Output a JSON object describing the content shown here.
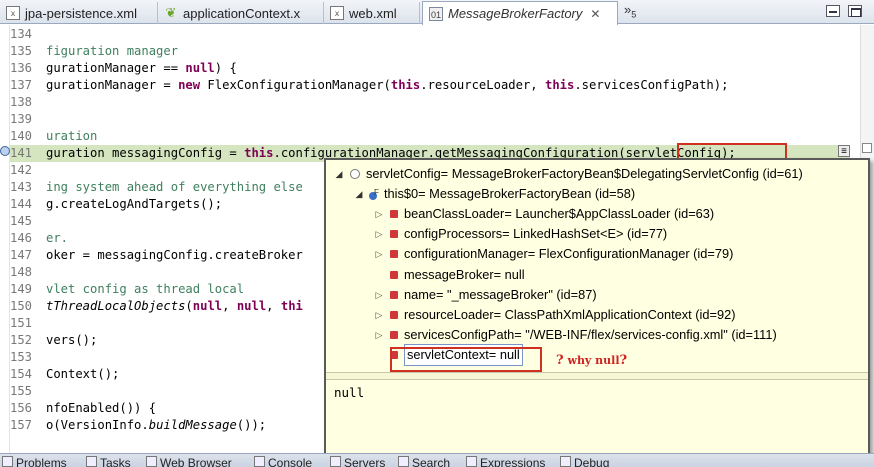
{
  "tabs": [
    {
      "label": "jpa-persistence.xml",
      "icon": "xml-file-icon",
      "active": false
    },
    {
      "label": "applicationContext.x",
      "icon": "spring-leaf-icon",
      "active": false
    },
    {
      "label": "web.xml",
      "icon": "xml-file-icon",
      "active": false
    },
    {
      "label": "MessageBrokerFactory",
      "icon": "class-file-icon",
      "active": true
    }
  ],
  "tab_overflow": {
    "symbol": "»",
    "count": "5"
  },
  "editor": {
    "lines": [
      {
        "num": "134",
        "segments": []
      },
      {
        "num": "135",
        "segments": [
          {
            "t": "figuration manager",
            "c": "cmt"
          }
        ]
      },
      {
        "num": "136",
        "segments": [
          {
            "t": "gurationManager == ",
            "c": ""
          },
          {
            "t": "null",
            "c": "kw"
          },
          {
            "t": ") {",
            "c": ""
          }
        ]
      },
      {
        "num": "137",
        "segments": [
          {
            "t": "gurationManager = ",
            "c": ""
          },
          {
            "t": "new",
            "c": "kw"
          },
          {
            "t": " FlexConfigurationManager(",
            "c": ""
          },
          {
            "t": "this",
            "c": "kw"
          },
          {
            "t": ".resourceLoader, ",
            "c": ""
          },
          {
            "t": "this",
            "c": "kw"
          },
          {
            "t": ".servicesConfigPath);",
            "c": ""
          }
        ]
      },
      {
        "num": "138",
        "segments": []
      },
      {
        "num": "139",
        "segments": []
      },
      {
        "num": "140",
        "segments": [
          {
            "t": "uration",
            "c": "cmt"
          }
        ]
      },
      {
        "num": "141",
        "segments": [
          {
            "t": "guration messagingConfig = ",
            "c": ""
          },
          {
            "t": "this",
            "c": "kw"
          },
          {
            "t": ".configurationManager.getMessagingConfiguration(servletConfig);",
            "c": ""
          }
        ],
        "highlight": true
      },
      {
        "num": "142",
        "segments": []
      },
      {
        "num": "143",
        "segments": [
          {
            "t": "ing system ahead of everything else",
            "c": "cmt"
          }
        ]
      },
      {
        "num": "144",
        "segments": [
          {
            "t": "g.createLogAndTargets();",
            "c": ""
          }
        ]
      },
      {
        "num": "145",
        "segments": []
      },
      {
        "num": "146",
        "segments": [
          {
            "t": "er.",
            "c": "cmt"
          }
        ]
      },
      {
        "num": "147",
        "segments": [
          {
            "t": "oker = messagingConfig.createBroker",
            "c": ""
          }
        ]
      },
      {
        "num": "148",
        "segments": []
      },
      {
        "num": "149",
        "segments": [
          {
            "t": "vlet config as thread local",
            "c": "cmt"
          }
        ]
      },
      {
        "num": "150",
        "segments": [
          {
            "t": "tThreadLocalObjects",
            "c": "it"
          },
          {
            "t": "(",
            "c": ""
          },
          {
            "t": "null",
            "c": "kw"
          },
          {
            "t": ", ",
            "c": ""
          },
          {
            "t": "null",
            "c": "kw"
          },
          {
            "t": ", ",
            "c": ""
          },
          {
            "t": "thi",
            "c": "kw"
          }
        ]
      },
      {
        "num": "151",
        "segments": []
      },
      {
        "num": "152",
        "segments": [
          {
            "t": "vers();",
            "c": ""
          }
        ]
      },
      {
        "num": "153",
        "segments": []
      },
      {
        "num": "154",
        "segments": [
          {
            "t": "Context();",
            "c": ""
          }
        ]
      },
      {
        "num": "155",
        "segments": []
      },
      {
        "num": "156",
        "segments": [
          {
            "t": "nfoEnabled()) {",
            "c": ""
          }
        ]
      },
      {
        "num": "157",
        "segments": [
          {
            "t": "o(VersionInfo.",
            "c": ""
          },
          {
            "t": "buildMessage",
            "c": "it"
          },
          {
            "t": "());",
            "c": ""
          }
        ]
      }
    ]
  },
  "inspect": {
    "root": "servletConfig= MessageBrokerFactoryBean$DelegatingServletConfig  (id=61)",
    "this_node": "this$0= MessageBrokerFactoryBean  (id=58)",
    "children": [
      {
        "label": "beanClassLoader= Launcher$AppClassLoader  (id=63)",
        "expandable": true
      },
      {
        "label": "configProcessors= LinkedHashSet<E>  (id=77)",
        "expandable": true
      },
      {
        "label": "configurationManager= FlexConfigurationManager  (id=79)",
        "expandable": true
      },
      {
        "label": "messageBroker= null",
        "expandable": false
      },
      {
        "label": "name= \"_messageBroker\" (id=87)",
        "expandable": true
      },
      {
        "label": "resourceLoader= ClassPathXmlApplicationContext  (id=92)",
        "expandable": true
      },
      {
        "label": "servicesConfigPath= \"/WEB-INF/flex/services-config.xml\" (id=111)",
        "expandable": true
      },
      {
        "label": "servletContext= null",
        "expandable": false
      }
    ],
    "annotation": "why null",
    "annotation_mark": "?",
    "detail_value": "null"
  },
  "views": [
    {
      "label": "Problems",
      "icon": "problems-icon"
    },
    {
      "label": "Tasks",
      "icon": "tasks-icon"
    },
    {
      "label": "Web Browser",
      "icon": "globe-icon"
    },
    {
      "label": "Console",
      "icon": "console-icon"
    },
    {
      "label": "Servers",
      "icon": "servers-icon"
    },
    {
      "label": "Search",
      "icon": "search-icon"
    },
    {
      "label": "Expressions",
      "icon": "expressions-icon"
    },
    {
      "label": "Debug",
      "icon": "debug-icon"
    }
  ]
}
